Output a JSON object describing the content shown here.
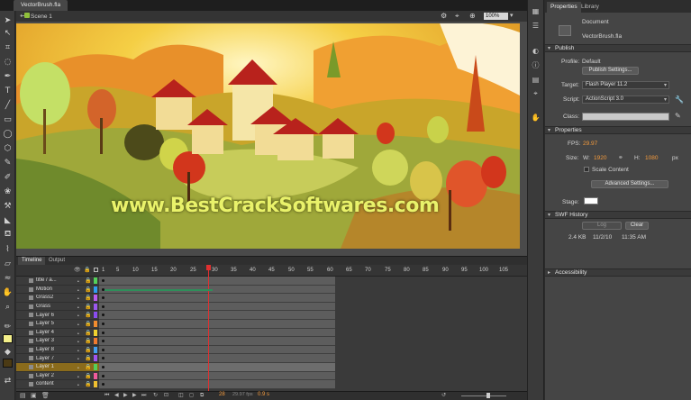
{
  "document_tab": "VectorBrush.fla",
  "editbar": {
    "scene": "Scene 1",
    "zoom": "100%"
  },
  "stage": {
    "watermark": "www.BestCrackSoftwares.com",
    "bg": "#d8a21e"
  },
  "timeline": {
    "tabs": [
      "Timeline",
      "Output"
    ],
    "ruler": [
      "1",
      "5",
      "10",
      "15",
      "20",
      "25",
      "30",
      "35",
      "40",
      "45",
      "50",
      "55",
      "60",
      "65",
      "70",
      "75",
      "80",
      "85",
      "90",
      "95",
      "100",
      "105"
    ],
    "playhead_frame": "28",
    "fps_readout": "29.97 fps",
    "elapsed": "0.9 s",
    "layers": [
      {
        "name": "title / a...",
        "color": "#54d05a"
      },
      {
        "name": "Motion",
        "color": "#2f9cf0"
      },
      {
        "name": "Grass2",
        "color": "#b95cf0"
      },
      {
        "name": "Grass",
        "color": "#9b57f0"
      },
      {
        "name": "Layer 6",
        "color": "#8a4cf0"
      },
      {
        "name": "Layer 5",
        "color": "#f08c2f"
      },
      {
        "name": "Layer 4",
        "color": "#f0d22f"
      },
      {
        "name": "Layer 3",
        "color": "#f07a2f"
      },
      {
        "name": "Layer 8",
        "color": "#44a0f0"
      },
      {
        "name": "Layer 7",
        "color": "#a054f0"
      },
      {
        "name": "Layer 1",
        "color": "#54d05a"
      },
      {
        "name": "Layer 2",
        "color": "#f05a9c"
      },
      {
        "name": "content",
        "color": "#f0c030"
      }
    ],
    "selected_layer": "Layer 1"
  },
  "properties": {
    "tabs": [
      "Properties",
      "Library"
    ],
    "doc_type": "Document",
    "doc_name": "VectorBrush.fla",
    "publish": {
      "title": "Publish",
      "profile_label": "Profile:",
      "profile": "Default",
      "settings_button": "Publish Settings...",
      "target_label": "Target:",
      "target": "Flash Player 11.2",
      "script_label": "Script:",
      "script": "ActionScript 3.0",
      "class_label": "Class:"
    },
    "props": {
      "title": "Properties",
      "fps_label": "FPS:",
      "fps": "29.97",
      "size_label": "Size:",
      "w_label": "W:",
      "w": "1920",
      "h_label": "H:",
      "h": "1080",
      "unit": "px",
      "scale_content": "Scale Content",
      "advanced_button": "Advanced Settings...",
      "stage_label": "Stage:"
    },
    "history": {
      "title": "SWF History",
      "log": "Log",
      "clear": "Clear",
      "size": "2.4 KB",
      "date": "11/2/10",
      "time": "11:35 AM"
    },
    "accessibility": "Accessibility"
  },
  "colors": {
    "accent": "#f39a3d",
    "playhead": "#e03030",
    "selection": "#8a6b1c"
  }
}
